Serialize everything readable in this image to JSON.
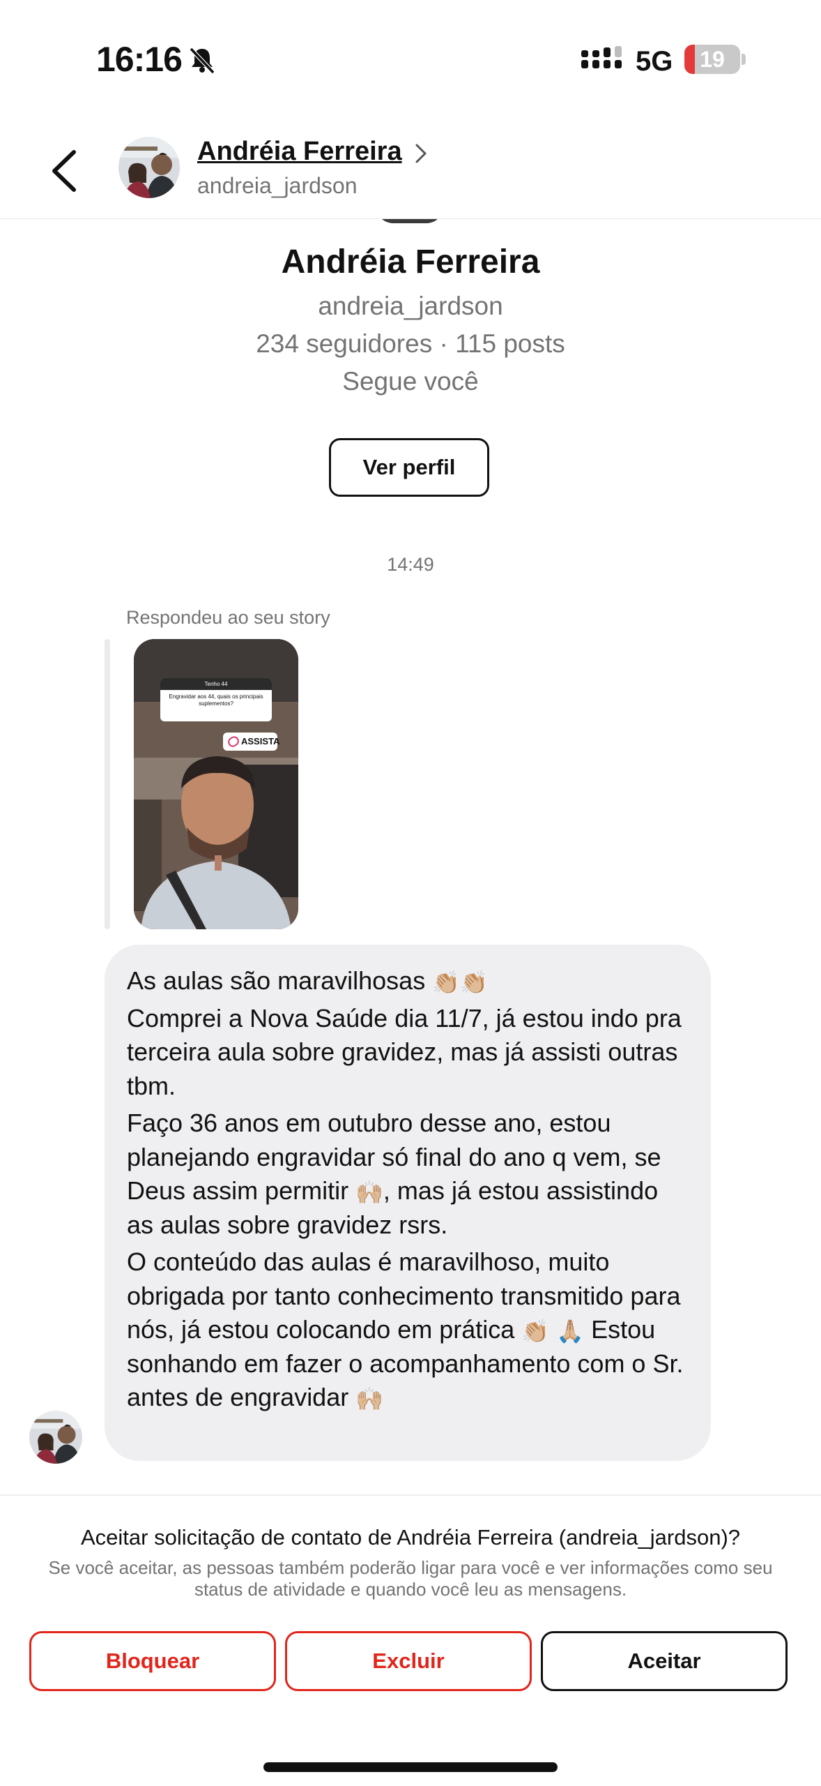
{
  "status_bar": {
    "time": "16:16",
    "network": "5G",
    "battery": "19",
    "battery_level_percent": 19,
    "icons": [
      "bell-slash-icon",
      "signal-icon",
      "battery-icon"
    ]
  },
  "header": {
    "name": "Andréia Ferreira",
    "username": "andreia_jardson",
    "icons": [
      "back-arrow-icon",
      "chevron-right-icon"
    ]
  },
  "profile": {
    "name": "Andréia Ferreira",
    "username": "andreia_jardson",
    "stats": "234 seguidores · 115 posts",
    "follows_you": "Segue você",
    "view_profile_label": "Ver perfil"
  },
  "chat": {
    "timestamp": "14:49",
    "replied_label": "Respondeu ao seu story",
    "story": {
      "question_header": "Tenho 44",
      "question_text": "Engravidar aos 44, quais os principais suplementos?",
      "link_label": "ASSISTA"
    },
    "message": {
      "line1": "As aulas são maravilhosas",
      "line1_emoji": "👏🏼👏🏼",
      "para2": "Comprei a Nova Saúde dia 11/7, já estou indo pra terceira aula sobre gravidez, mas já assisti outras tbm.",
      "para3_a": "Faço 36 anos em outubro desse ano, estou planejando engravidar só final do ano q vem, se Deus assim permitir",
      "para3_emoji": "🙌🏼",
      "para3_b": ", mas já estou assistindo as aulas sobre gravidez rsrs.",
      "para4_a": "O conteúdo das aulas é maravilhoso, muito obrigada por tanto conhecimento transmitido para nós, já estou colocando em prática",
      "para4_emoji1": "👏🏼",
      "para4_emoji2": "🙏🏼",
      "para4_b": "Estou sonhando em fazer o acompanhamento com o Sr. antes de engravidar",
      "para4_emoji3": "🙌🏼"
    }
  },
  "request": {
    "question": "Aceitar solicitação de contato de Andréia Ferreira (andreia_jardson)?",
    "info": "Se você aceitar, as pessoas também poderão ligar para você e ver informações como seu status de atividade e quando você leu as mensagens.",
    "block_label": "Bloquear",
    "delete_label": "Excluir",
    "accept_label": "Aceitar"
  },
  "colors": {
    "danger": "#e1251b",
    "bubble": "#efeff1",
    "muted": "#737373",
    "battery_low": "#e5393a"
  }
}
